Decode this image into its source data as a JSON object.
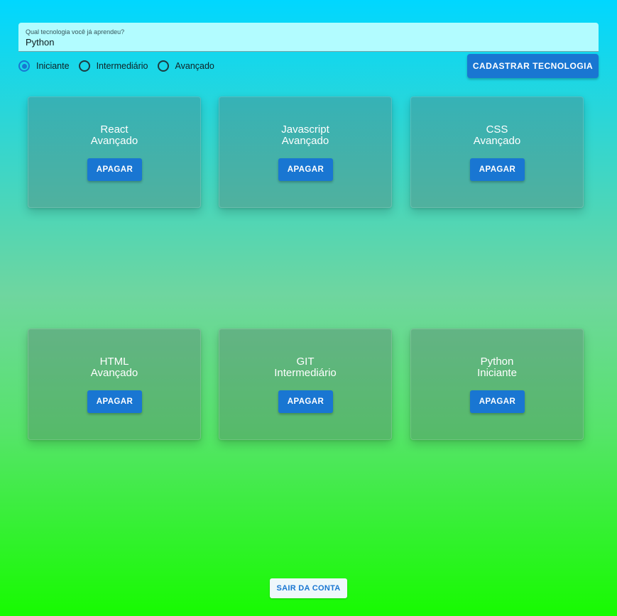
{
  "form": {
    "label": "Qual tecnologia você já aprendeu?",
    "value": "Python",
    "levels": [
      "Iniciante",
      "Intermediário",
      "Avançado"
    ],
    "selected_level": "Iniciante",
    "submit_label": "CADASTRAR TECNOLOGIA"
  },
  "cards": [
    {
      "name": "React",
      "level": "Avançado",
      "button": "APAGAR"
    },
    {
      "name": "Javascript",
      "level": "Avançado",
      "button": "APAGAR"
    },
    {
      "name": "CSS",
      "level": "Avançado",
      "button": "APAGAR"
    },
    {
      "name": "HTML",
      "level": "Avançado",
      "button": "APAGAR"
    },
    {
      "name": "GIT",
      "level": "Intermediário",
      "button": "APAGAR"
    },
    {
      "name": "Python",
      "level": "Iniciante",
      "button": "APAGAR"
    }
  ],
  "logout_label": "SAIR DA CONTA",
  "colors": {
    "primary": "#1976d2",
    "input_background": "#b2fcff",
    "gradient_top": "#00d7ff",
    "gradient_bottom": "#17fb00"
  }
}
